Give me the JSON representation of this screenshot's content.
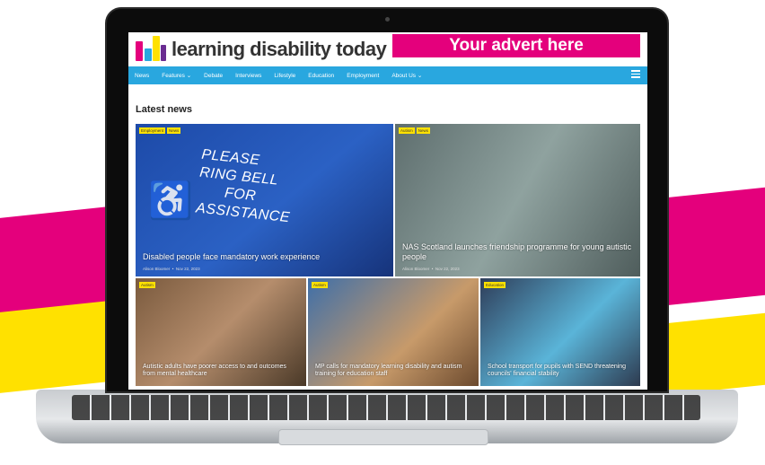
{
  "brand_colors": {
    "pink": "#e4007c",
    "yellow": "#ffe100",
    "nav_blue": "#29a7df"
  },
  "site": {
    "name": "learning disability today",
    "logo_letters": "ldt",
    "advert": "Your advert here"
  },
  "nav": {
    "items": [
      "News",
      "Features ⌄",
      "Debate",
      "Interviews",
      "Lifestyle",
      "Education",
      "Employment",
      "About Us ⌄"
    ],
    "menu_icon": "hamburger-icon"
  },
  "section_title": "Latest news",
  "articles": [
    {
      "tags": [
        "Employment",
        "News"
      ],
      "sign_lines": [
        "PLEASE",
        "RING BELL",
        "FOR",
        "ASSISTANCE"
      ],
      "headline": "Disabled people face mandatory work experience",
      "author": "Alison Bloomer",
      "date": "Nov 22, 2023"
    },
    {
      "tags": [
        "Autism",
        "News"
      ],
      "headline": "NAS Scotland launches friendship programme for young autistic people",
      "author": "Alison Bloomer",
      "date": "Nov 22, 2023"
    },
    {
      "tags": [
        "Autism"
      ],
      "headline": "Autistic adults have poorer access to and outcomes from mental healthcare"
    },
    {
      "tags": [
        "Autism"
      ],
      "headline": "MP calls for mandatory learning disability and autism training for education staff"
    },
    {
      "tags": [
        "Education"
      ],
      "headline": "School transport for pupils with SEND threatening councils' financial stability"
    }
  ]
}
